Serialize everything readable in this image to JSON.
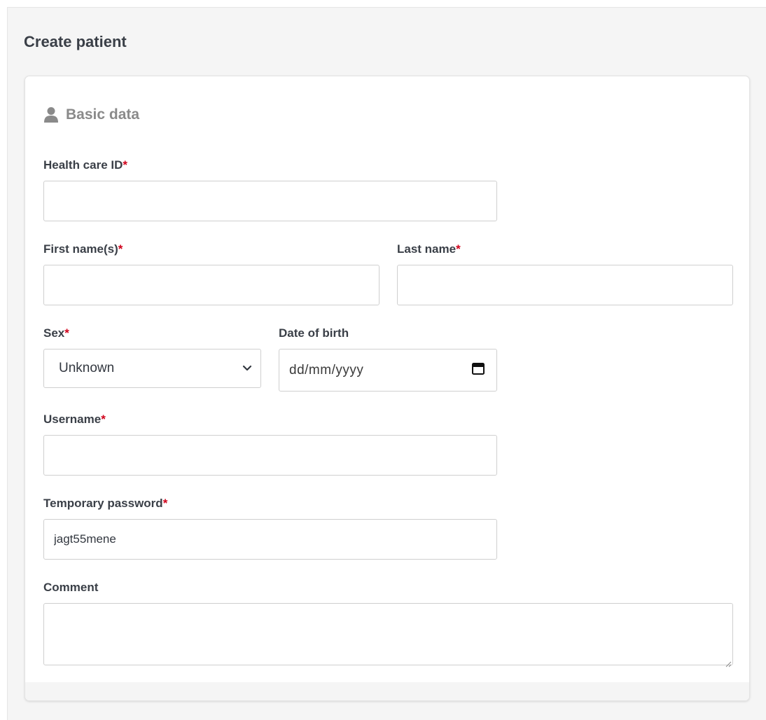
{
  "page": {
    "title": "Create patient"
  },
  "section": {
    "title": "Basic data",
    "icon": "user-icon"
  },
  "form": {
    "required_mark": "*",
    "health_care_id": {
      "label": "Health care ID",
      "value": ""
    },
    "first_name": {
      "label": "First name(s)",
      "value": ""
    },
    "last_name": {
      "label": "Last name",
      "value": ""
    },
    "sex": {
      "label": "Sex",
      "selected": "Unknown"
    },
    "date_of_birth": {
      "label": "Date of birth",
      "placeholder": "dd/mm/yyyy"
    },
    "username": {
      "label": "Username",
      "value": ""
    },
    "temporary_password": {
      "label": "Temporary password",
      "value": "jagt55mene"
    },
    "comment": {
      "label": "Comment",
      "value": ""
    }
  },
  "colors": {
    "required": "#d0021b",
    "panel_bg": "#f5f5f5",
    "section_title": "#8a8a8a"
  }
}
